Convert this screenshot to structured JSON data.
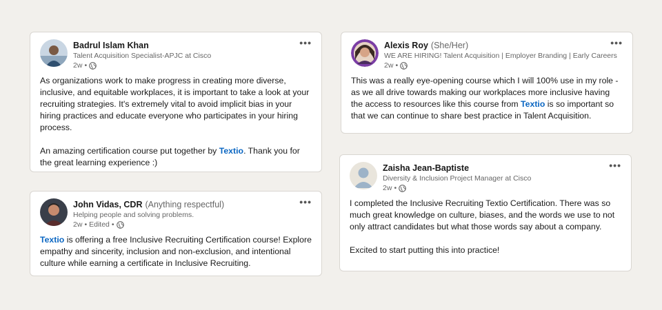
{
  "posts": [
    {
      "author": "Badrul Islam Khan",
      "pronouns": "",
      "headline": "Talent Acquisition Specialist-APJC at Cisco",
      "time": "2w",
      "edited": "",
      "avatar_icon": "profile-photo",
      "body": [
        "As organizations work to make progress in creating more diverse, inclusive, and equitable workplaces, it is important to take a look at your recruiting strategies. It's extremely vital to avoid implicit bias in your hiring practices and educate everyone who participates in your hiring process.",
        {
          "before": "An amazing certification course put together by ",
          "mention": "Textio",
          "after": ". Thank you for the great learning experience :)"
        }
      ]
    },
    {
      "author": "John Vidas, CDR",
      "pronouns": "(Anything respectful)",
      "headline": "Helping people and solving problems.",
      "time": "2w",
      "edited": "Edited",
      "avatar_icon": "profile-photo",
      "body": [
        {
          "before": "",
          "mention": "Textio",
          "after": " is offering a free Inclusive Recruiting Certification course! Explore empathy and sincerity, inclusion and non-exclusion, and intentional culture while earning a certificate in Inclusive Recruiting."
        }
      ]
    },
    {
      "author": "Alexis Roy",
      "pronouns": "(She/Her)",
      "headline": "WE ARE HIRING! Talent Acquisition | Employer Branding | Early Careers",
      "time": "2w",
      "edited": "",
      "avatar_icon": "profile-photo-hiring-frame",
      "body": [
        {
          "before": "This was a really eye-opening course which I will 100% use in my role - as we all drive towards making our workplaces more inclusive having the access to resources like this course from ",
          "mention": "Textio",
          "after": " is so important so that we can continue to share best practice in Talent Acquisition."
        }
      ]
    },
    {
      "author": "Zaisha Jean-Baptiste",
      "pronouns": "",
      "headline": "Diversity & Inclusion Project Manager at Cisco",
      "time": "2w",
      "edited": "",
      "avatar_icon": "default-avatar",
      "body": [
        "I completed the Inclusive Recruiting Textio Certification. There was so much great knowledge on culture, biases, and the words we use to not only attract candidates but what those words say about a company.",
        "Excited to start putting this into practice!"
      ]
    }
  ],
  "ui": {
    "more_label": "•••",
    "separator": "•"
  },
  "colors": {
    "background": "#f2f0ec",
    "mention": "#0a66c2",
    "hiring_frame": "#7b3ea5"
  }
}
